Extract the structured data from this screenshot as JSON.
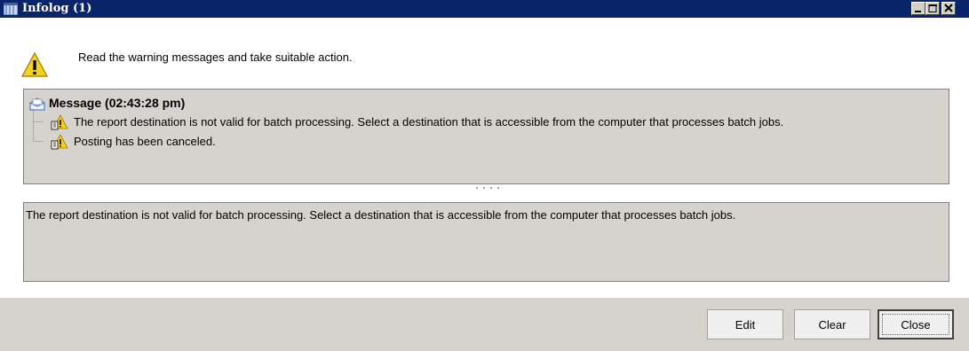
{
  "window": {
    "title": "Infolog (1)",
    "title_bar_color": "#0a246a",
    "icon": "infolog-icon",
    "controls": [
      "minimize-icon",
      "maximize-icon",
      "close-icon"
    ]
  },
  "header": {
    "icon": "warning-icon",
    "text": "Read the warning messages and take suitable action."
  },
  "tree": {
    "root": {
      "icon": "message-envelope-icon",
      "label": "Message (02:43:28 pm)"
    },
    "items": [
      {
        "icon": "warning-icon",
        "text": "The report destination is not valid for batch processing. Select a destination that is accessible from the computer that processes batch jobs."
      },
      {
        "icon": "warning-icon",
        "text": "Posting has been canceled."
      }
    ]
  },
  "detail": {
    "text": "The report destination is not valid for batch processing. Select a destination that is accessible from the computer that processes batch jobs."
  },
  "buttons": {
    "edit": "Edit",
    "clear": "Clear",
    "close": "Close"
  }
}
